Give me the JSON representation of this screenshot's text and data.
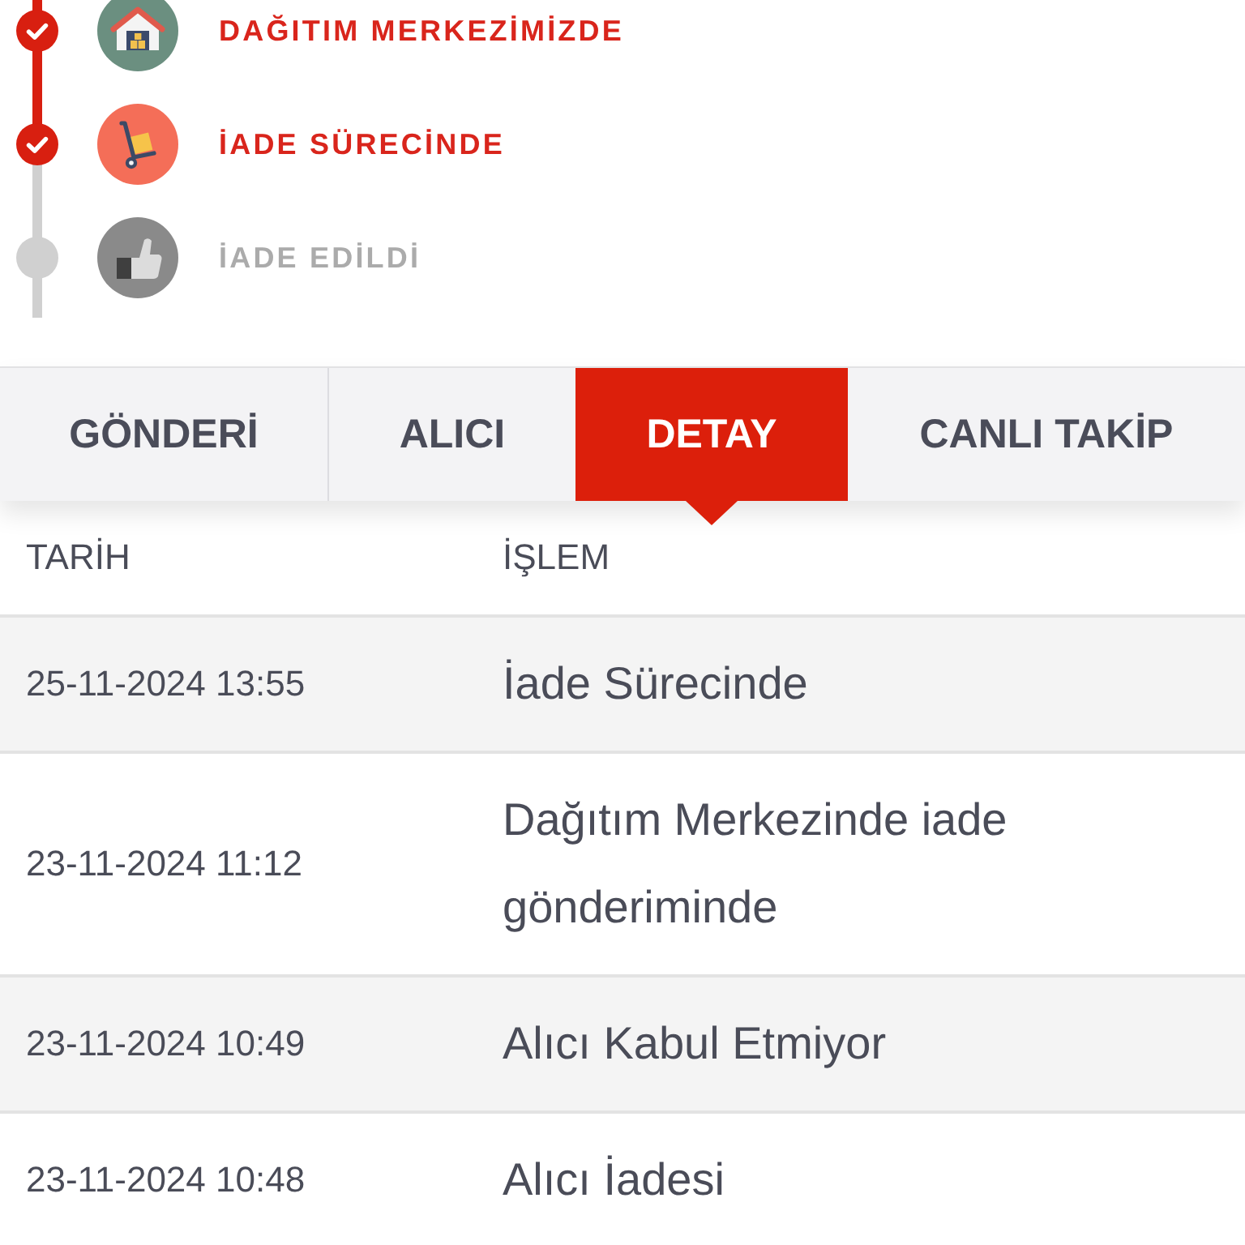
{
  "timeline": {
    "steps": [
      {
        "kind": "warehouse",
        "label": "DAĞITIM MERKEZİMİZDE",
        "done": true
      },
      {
        "kind": "trolley",
        "label": "İADE SÜRECİNDE",
        "done": true
      },
      {
        "kind": "thumbs",
        "label": "İADE EDİLDİ",
        "done": false
      }
    ]
  },
  "tabs": [
    {
      "label": "GÖNDERİ",
      "selected": false
    },
    {
      "label": "ALICI",
      "selected": false
    },
    {
      "label": "DETAY",
      "selected": true
    },
    {
      "label": "CANLI TAKİP",
      "selected": false
    }
  ],
  "table": {
    "columns": [
      "TARİH",
      "İŞLEM"
    ],
    "rows": [
      {
        "date": "25-11-2024 13:55",
        "action": "İade Sürecinde"
      },
      {
        "date": "23-11-2024 11:12",
        "action": "Dağıtım Merkezinde iade gönderiminde"
      },
      {
        "date": "23-11-2024 10:49",
        "action": "Alıcı Kabul Etmiyor"
      },
      {
        "date": "23-11-2024 10:48",
        "action": "Alıcı İadesi"
      }
    ]
  }
}
